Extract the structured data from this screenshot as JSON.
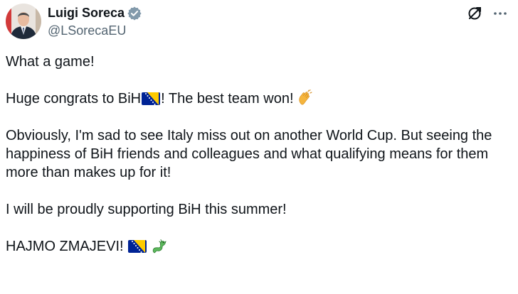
{
  "author": {
    "display_name": "Luigi Soreca",
    "handle": "@LSorecaEU",
    "verified": true,
    "avatar_icon": "profile-photo"
  },
  "actions": {
    "grok_icon": "grok-icon",
    "more_icon": "more-icon"
  },
  "tweet": {
    "line1": "What a game!",
    "line2_a": "Huge congrats to BiH",
    "line2_b": "! The best team won!",
    "line3": "Obviously, I'm sad to see Italy miss out on another World Cup. But seeing the happiness of BiH friends and colleagues and what qualifying means for them more than makes up for it!",
    "line4": "I will be proudly supporting BiH this summer!",
    "line5": "HAJMO ZMAJEVI!"
  },
  "colors": {
    "text": "#0f1419",
    "secondary": "#536471",
    "verified_badge": "#829aab",
    "bih_flag_blue": "#002395",
    "bih_flag_yellow": "#fecb00"
  }
}
